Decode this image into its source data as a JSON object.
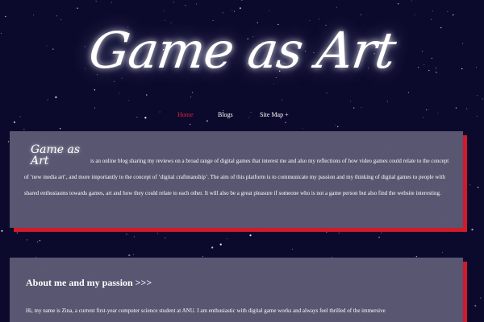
{
  "site": {
    "logo_text": "Game as Art"
  },
  "nav": {
    "home": "Home",
    "blogs": "Blogs",
    "site_map": "Site Map +"
  },
  "intro": {
    "logo_text": "Game as Art",
    "body": "is an online blog sharing my reviews on a broad range of digital games that interest me and also my reflections of how video games could relate to the concept of ‘new media art’, and more importantly to the concept of ‘digital craftmanship’. The aim of this platform is to communicate my passion and my thinking of digital games to people with shared enthusiasms towards games, art and how they could relate to each other. It will also be a great pleasure if someone who is not a game person but also find the website interesting."
  },
  "about": {
    "heading": "About me and my passion >>>",
    "body": "Hi, my name is Zina, a current first-year computer science student at ANU. I am enthusiastic with digital game works and always feel thrilled of the immersive"
  },
  "colors": {
    "background": "#0c0a2c",
    "card": "#5c5974",
    "accent_shadow": "#d11a2a",
    "active_nav": "#e0223a"
  }
}
